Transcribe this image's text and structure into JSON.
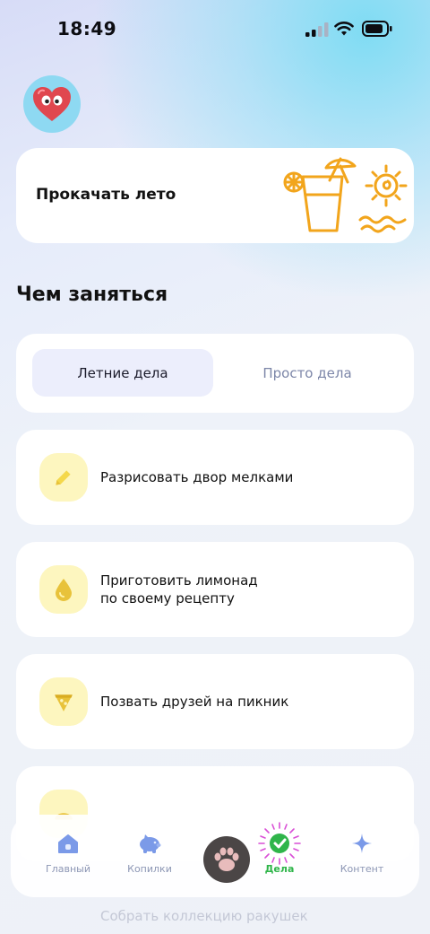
{
  "status": {
    "time": "18:49"
  },
  "promo": {
    "title": "Прокачать лето"
  },
  "section": {
    "title": "Чем заняться"
  },
  "tabs": [
    {
      "label": "Летние дела",
      "active": true
    },
    {
      "label": "Просто дела",
      "active": false
    }
  ],
  "tasks": [
    {
      "icon": "pencil-icon",
      "line1": "Разрисовать двор мелками",
      "line2": ""
    },
    {
      "icon": "drop-icon",
      "line1": "Приготовить лимонад",
      "line2": "по своему рецепту"
    },
    {
      "icon": "pizza-icon",
      "line1": "Позвать друзей на пикник",
      "line2": ""
    },
    {
      "icon": "shell-icon",
      "line1": "Собрать коллекцию ракушек",
      "line2": ""
    }
  ],
  "nav": {
    "items": [
      {
        "label": "Главный",
        "icon": "home-icon"
      },
      {
        "label": "Копилки",
        "icon": "piggy-bank-icon"
      },
      {
        "label": "",
        "icon": "paw-icon"
      },
      {
        "label": "Дела",
        "icon": "check-circle-icon",
        "active": true
      },
      {
        "label": "Контент",
        "icon": "sparkle-icon"
      }
    ]
  },
  "colors": {
    "accent_green": "#2fb54a",
    "promo_orange": "#f2a51c",
    "task_icon_bg": "#fdf6bf",
    "tab_active_bg": "#eceefc"
  }
}
